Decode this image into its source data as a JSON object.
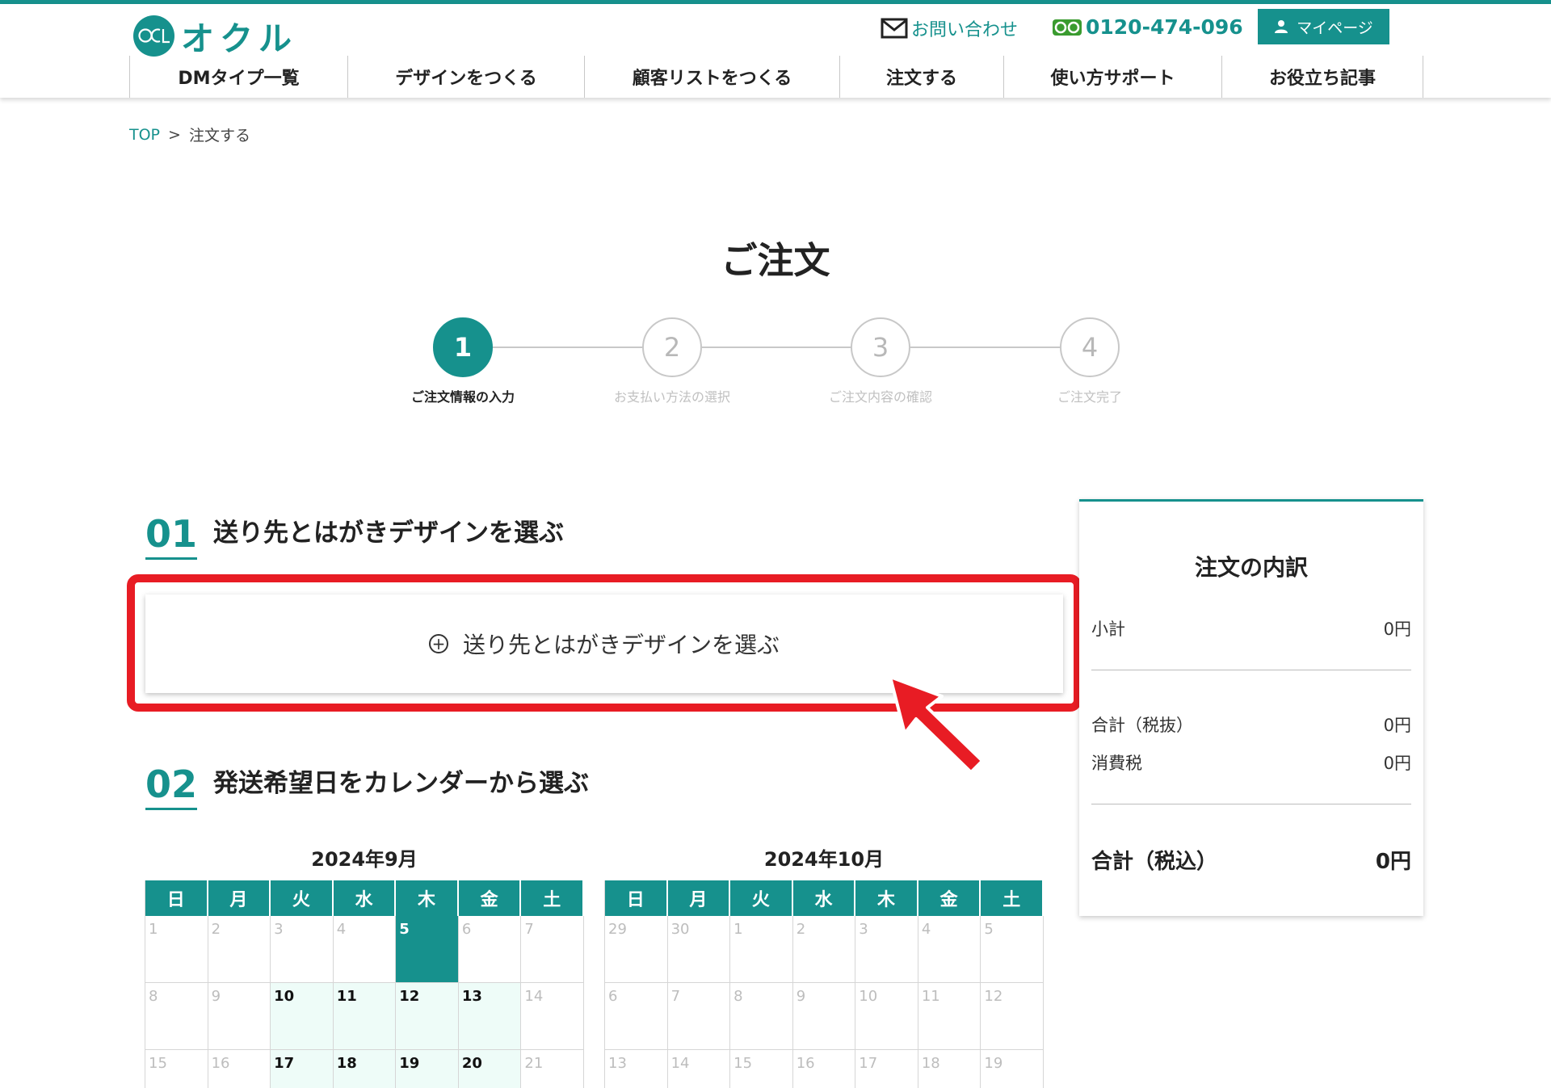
{
  "header": {
    "logo_text": "オクル",
    "contact_label": "お問い合わせ",
    "phone_number": "0120-474-096",
    "mypage_label": "マイページ"
  },
  "nav": {
    "items": [
      {
        "label": "DMタイプ一覧"
      },
      {
        "label": "デザインをつくる"
      },
      {
        "label": "顧客リストをつくる"
      },
      {
        "label": "注文する"
      },
      {
        "label": "使い方サポート"
      },
      {
        "label": "お役立ち記事"
      }
    ]
  },
  "breadcrumb": {
    "top": "TOP",
    "separator": ">",
    "current": "注文する"
  },
  "page": {
    "title": "ご注文"
  },
  "steps": {
    "items": [
      {
        "number": "1",
        "label": "ご注文情報の入力",
        "active": true
      },
      {
        "number": "2",
        "label": "お支払い方法の選択",
        "active": false
      },
      {
        "number": "3",
        "label": "ご注文内容の確認",
        "active": false
      },
      {
        "number": "4",
        "label": "ご注文完了",
        "active": false
      }
    ]
  },
  "section1": {
    "number": "01",
    "title": "送り先とはがきデザインを選ぶ",
    "select_button": "送り先とはがきデザインを選ぶ",
    "plus_icon": "⊕"
  },
  "section2": {
    "number": "02",
    "title": "発送希望日をカレンダーから選ぶ"
  },
  "summary": {
    "title": "注文の内訳",
    "subtotal_label": "小計",
    "subtotal_value": "0円",
    "total_excl_label": "合計（税抜）",
    "total_excl_value": "0円",
    "tax_label": "消費税",
    "tax_value": "0円",
    "total_incl_label": "合計（税込）",
    "total_incl_value": "0円"
  },
  "calendar": {
    "weekdays": [
      "日",
      "月",
      "火",
      "水",
      "木",
      "金",
      "土"
    ],
    "months": [
      {
        "title": "2024年9月",
        "cells": [
          {
            "d": "1",
            "s": "off"
          },
          {
            "d": "2",
            "s": "off"
          },
          {
            "d": "3",
            "s": "off"
          },
          {
            "d": "4",
            "s": "off"
          },
          {
            "d": "5",
            "s": "selected"
          },
          {
            "d": "6",
            "s": "off"
          },
          {
            "d": "7",
            "s": "off"
          },
          {
            "d": "8",
            "s": "off"
          },
          {
            "d": "9",
            "s": "off"
          },
          {
            "d": "10",
            "s": "avail"
          },
          {
            "d": "11",
            "s": "avail"
          },
          {
            "d": "12",
            "s": "avail"
          },
          {
            "d": "13",
            "s": "avail"
          },
          {
            "d": "14",
            "s": "off"
          },
          {
            "d": "15",
            "s": "off"
          },
          {
            "d": "16",
            "s": "off"
          },
          {
            "d": "17",
            "s": "avail"
          },
          {
            "d": "18",
            "s": "avail"
          },
          {
            "d": "19",
            "s": "avail"
          },
          {
            "d": "20",
            "s": "avail"
          },
          {
            "d": "21",
            "s": "off"
          }
        ]
      },
      {
        "title": "2024年10月",
        "cells": [
          {
            "d": "29",
            "s": "off"
          },
          {
            "d": "30",
            "s": "off"
          },
          {
            "d": "1",
            "s": "off"
          },
          {
            "d": "2",
            "s": "off"
          },
          {
            "d": "3",
            "s": "off"
          },
          {
            "d": "4",
            "s": "off"
          },
          {
            "d": "5",
            "s": "off"
          },
          {
            "d": "6",
            "s": "off"
          },
          {
            "d": "7",
            "s": "off"
          },
          {
            "d": "8",
            "s": "off"
          },
          {
            "d": "9",
            "s": "off"
          },
          {
            "d": "10",
            "s": "off"
          },
          {
            "d": "11",
            "s": "off"
          },
          {
            "d": "12",
            "s": "off"
          },
          {
            "d": "13",
            "s": "off"
          },
          {
            "d": "14",
            "s": "off"
          },
          {
            "d": "15",
            "s": "off"
          },
          {
            "d": "16",
            "s": "off"
          },
          {
            "d": "17",
            "s": "off"
          },
          {
            "d": "18",
            "s": "off"
          },
          {
            "d": "19",
            "s": "off"
          }
        ]
      }
    ]
  },
  "colors": {
    "brand": "#16918d",
    "highlight": "#e81c24",
    "available_day": "#eefcf8"
  }
}
